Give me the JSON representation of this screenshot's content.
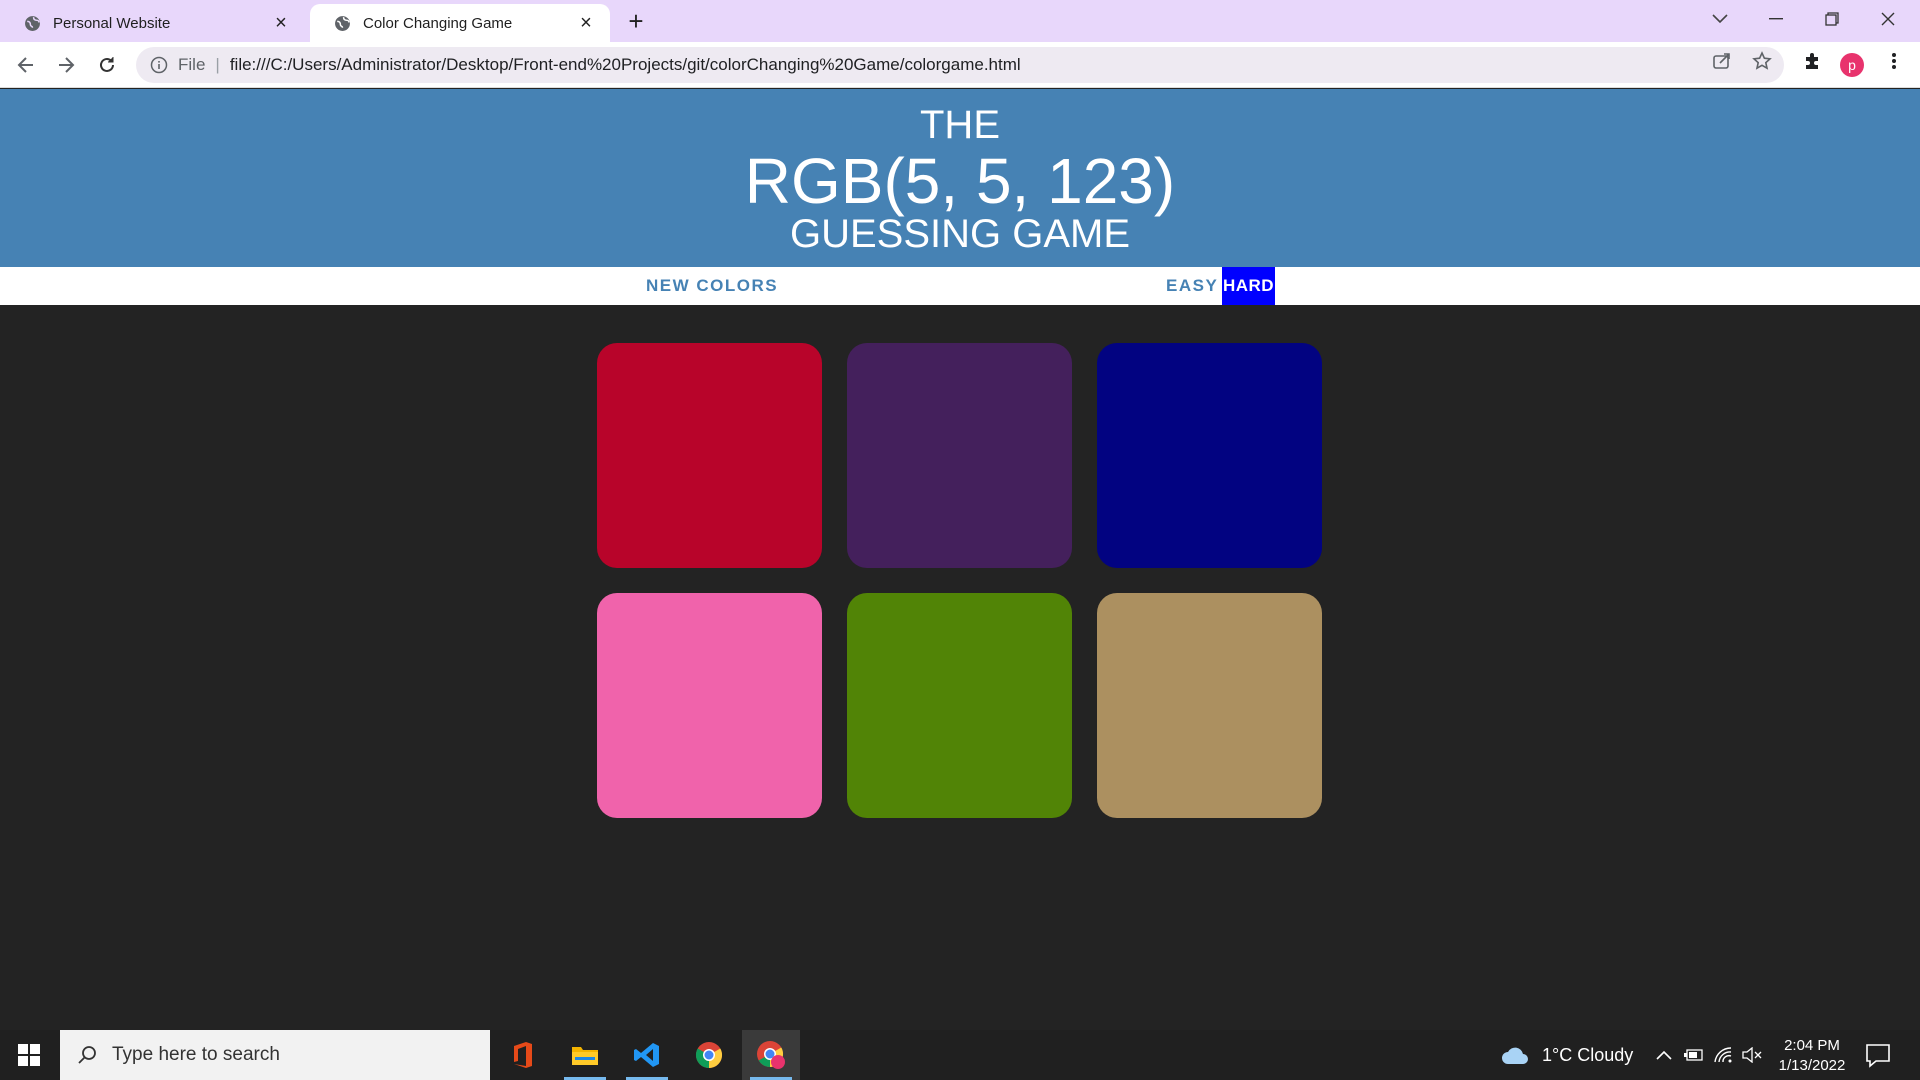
{
  "browser": {
    "tabs": [
      {
        "title": "Personal Website",
        "active": false
      },
      {
        "title": "Color Changing Game",
        "active": true
      }
    ],
    "address": {
      "scheme_label": "File",
      "url": "file:///C:/Users/Administrator/Desktop/Front-end%20Projects/git/colorChanging%20Game/colorgame.html"
    },
    "profile_initial": "p",
    "icons": [
      "back-icon",
      "forward-icon",
      "reload-icon",
      "info-icon",
      "share-icon",
      "star-icon",
      "extensions-icon",
      "menu-icon"
    ]
  },
  "game": {
    "header": {
      "line1": "THE",
      "color_display": "RGB(5, 5, 123)",
      "line3": "GUESSING GAME"
    },
    "controls": {
      "new_colors": "NEW COLORS",
      "easy": "EASY",
      "hard": "HARD",
      "selected_mode": "HARD"
    },
    "header_color": "#4682b4",
    "background_color": "#232323",
    "squares": [
      {
        "color": "#b8042a"
      },
      {
        "color": "#44205c"
      },
      {
        "color": "#020381"
      },
      {
        "color": "#f063ab"
      },
      {
        "color": "#518406"
      },
      {
        "color": "#ac9060"
      }
    ]
  },
  "taskbar": {
    "search_placeholder": "Type here to search",
    "apps": [
      "office-icon",
      "file-explorer-icon",
      "vscode-icon",
      "chrome-icon",
      "chrome-profile-icon"
    ],
    "weather": "1°C  Cloudy",
    "time": "2:04 PM",
    "date": "1/13/2022"
  }
}
